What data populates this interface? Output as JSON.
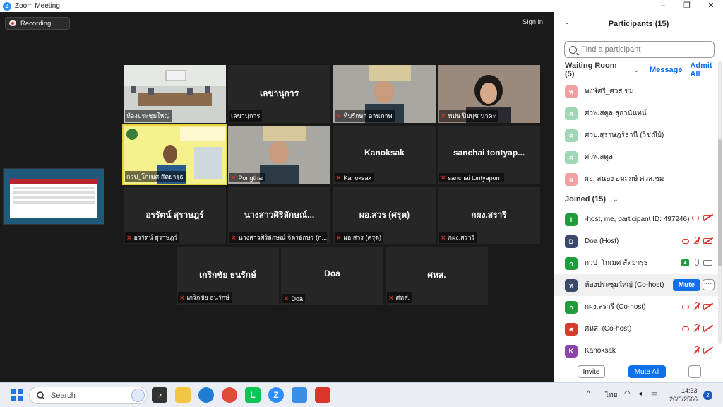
{
  "window": {
    "title": "Zoom Meeting",
    "minimize": "–",
    "maximize": "❐",
    "close": "✕",
    "logo": "Z"
  },
  "meeting": {
    "recording_label": "Recording...",
    "sign_in": "Sign in"
  },
  "tiles": [
    {
      "display": "",
      "label": "ห้องประชุมใหญ่",
      "muted": false,
      "video": "meeting-room"
    },
    {
      "display": "เลขานุการ",
      "label": "เลขานุการ",
      "muted": false,
      "video": ""
    },
    {
      "display": "",
      "label": "ทิบรักษา อานภาพ",
      "muted": true,
      "video": "person"
    },
    {
      "display": "",
      "label": "ทปษ ปิยนุช นาคะ",
      "muted": true,
      "video": "person-woman"
    },
    {
      "display": "",
      "label": "กวป_โกเมศ สัตยารุธ",
      "muted": false,
      "video": "slide-person"
    },
    {
      "display": "",
      "label": "Pongthai",
      "muted": true,
      "video": "person"
    },
    {
      "display": "Kanoksak",
      "label": "Kanoksak",
      "muted": true,
      "video": ""
    },
    {
      "display": "sanchai tontyap...",
      "label": "sanchai tontyaporn",
      "muted": true,
      "video": ""
    },
    {
      "display": "อรรัตน์ สุราษฎร์",
      "label": "อรรัตน์ สุราษฎร์",
      "muted": true,
      "video": ""
    },
    {
      "display": "นางสาวศิริลักษณ์...",
      "label": "นางสาวศิริลักษณ์ จิตรอักษร (ก...",
      "muted": true,
      "video": ""
    },
    {
      "display": "ผอ.สวร (ศรุต)",
      "label": "ผอ.สวร (ศรุต)",
      "muted": true,
      "video": ""
    },
    {
      "display": "กผง.สรารี",
      "label": "กผง.สรารี",
      "muted": true,
      "video": ""
    },
    {
      "display": "เกริกชัย ธนรักษ์",
      "label": "เกริกชัย ธนรักษ์",
      "muted": true,
      "video": ""
    },
    {
      "display": "Doa",
      "label": "Doa",
      "muted": true,
      "video": ""
    },
    {
      "display": "ศหส.",
      "label": "ศหส.",
      "muted": true,
      "video": ""
    }
  ],
  "panel": {
    "title": "Participants (15)",
    "search_placeholder": "Find a participant",
    "waiting_room": "Waiting Room (5)",
    "message": "Message",
    "admit_all": "Admit All",
    "waiting": [
      {
        "initial": "พ",
        "name": "พงษ์ศรี_ศวส.ชม.",
        "color": "#f0a0a0"
      },
      {
        "initial": "ศ",
        "name": "ศวพ.สตูล สุกานันทน์",
        "color": "#9fd6b4"
      },
      {
        "initial": "ศ",
        "name": "ศวป.สุราษฎร์ธานี (วิชณีย์)",
        "color": "#9fd6b4"
      },
      {
        "initial": "ศ",
        "name": "ศวพ.สตูล",
        "color": "#9fd6b4"
      },
      {
        "initial": "ผ",
        "name": "ผอ. สนอง อมฤกษ์  ศวส.ชม",
        "color": "#f0a0a0"
      }
    ],
    "joined": "Joined (15)",
    "participants": [
      {
        "initial": "l",
        "name": "-host, me, participant ID: 497246)",
        "color": "#1e9e3a"
      },
      {
        "initial": "D",
        "name": "Doa (Host)",
        "color": "#3b4a6b"
      },
      {
        "initial": "ก",
        "name": "กวป_โกเมศ สัตยารุธ",
        "color": "#1e9e3a"
      },
      {
        "initial": "ห",
        "name": "ห้องประชุมใหญ่ (Co-host)",
        "color": "#3b4a6b"
      },
      {
        "initial": "ก",
        "name": "กผง.สรารี (Co-host)",
        "color": "#1e9e3a"
      },
      {
        "initial": "ศ",
        "name": "ศหส. (Co-host)",
        "color": "#d43c2c"
      },
      {
        "initial": "K",
        "name": "Kanoksak",
        "color": "#8e44ad"
      }
    ],
    "mute_label": "Mute",
    "more_label": "···",
    "invite": "Invite",
    "mute_all": "Mute All",
    "footer_more": "···"
  },
  "taskbar": {
    "search": "Search",
    "lang": "ไทย",
    "time": "14:33",
    "date": "26/6/2566",
    "notifications": "2",
    "tray_up": "^"
  }
}
